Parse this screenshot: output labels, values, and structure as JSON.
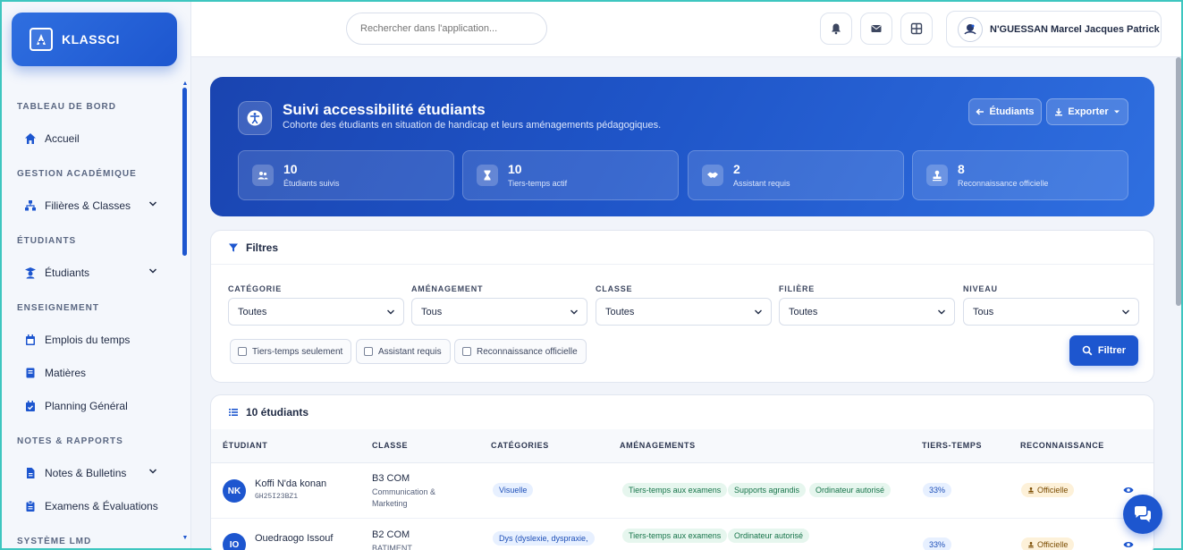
{
  "app": {
    "name": "KLASSCI"
  },
  "sidebar": {
    "sections": [
      {
        "title": "TABLEAU DE BORD",
        "items": [
          {
            "label": "Accueil",
            "icon": "home-icon"
          }
        ]
      },
      {
        "title": "GESTION ACADÉMIQUE",
        "items": [
          {
            "label": "Filières & Classes",
            "icon": "sitemap-icon",
            "expandable": true
          }
        ]
      },
      {
        "title": "ÉTUDIANTS",
        "items": [
          {
            "label": "Étudiants",
            "icon": "graduate-icon",
            "expandable": true
          }
        ]
      },
      {
        "title": "ENSEIGNEMENT",
        "items": [
          {
            "label": "Emplois du temps",
            "icon": "calendar-icon"
          },
          {
            "label": "Matières",
            "icon": "book-icon"
          },
          {
            "label": "Planning Général",
            "icon": "calendar-check-icon"
          }
        ]
      },
      {
        "title": "NOTES & RAPPORTS",
        "items": [
          {
            "label": "Notes & Bulletins",
            "icon": "file-icon",
            "expandable": true
          },
          {
            "label": "Examens & Évaluations",
            "icon": "clipboard-icon"
          }
        ]
      },
      {
        "title": "SYSTÈME LMD",
        "items": []
      }
    ]
  },
  "topbar": {
    "search_placeholder": "Rechercher dans l'application...",
    "user_name": "N'GUESSAN Marcel Jacques Patrick"
  },
  "hero": {
    "title": "Suivi accessibilité étudiants",
    "subtitle": "Cohorte des étudiants en situation de handicap et leurs aménagements pédagogiques.",
    "back_button": "Étudiants",
    "export_button": "Exporter",
    "stats": [
      {
        "value": "10",
        "label": "Étudiants suivis",
        "icon": "users-icon"
      },
      {
        "value": "10",
        "label": "Tiers-temps actif",
        "icon": "hourglass-icon"
      },
      {
        "value": "2",
        "label": "Assistant requis",
        "icon": "handshake-icon"
      },
      {
        "value": "8",
        "label": "Reconnaissance officielle",
        "icon": "stamp-icon"
      }
    ]
  },
  "filters": {
    "title": "Filtres",
    "fields": [
      {
        "label": "CATÉGORIE",
        "value": "Toutes"
      },
      {
        "label": "AMÉNAGEMENT",
        "value": "Tous"
      },
      {
        "label": "CLASSE",
        "value": "Toutes"
      },
      {
        "label": "FILIÈRE",
        "value": "Toutes"
      },
      {
        "label": "NIVEAU",
        "value": "Tous"
      }
    ],
    "checkboxes": [
      "Tiers-temps seulement",
      "Assistant requis",
      "Reconnaissance officielle"
    ],
    "submit": "Filtrer"
  },
  "table": {
    "title": "10 étudiants",
    "columns": [
      "ÉTUDIANT",
      "CLASSE",
      "CATÉGORIES",
      "AMÉNAGEMENTS",
      "TIERS-TEMPS",
      "RECONNAISSANCE"
    ],
    "rows": [
      {
        "initials": "NK",
        "name": "Koffi N'da konan",
        "matricule": "GH25I23BZ1",
        "class": "B3 COM",
        "class_sub": "Communication & Marketing",
        "categories": [
          "Visuelle"
        ],
        "amenagements": [
          "Tiers-temps aux examens",
          "Supports agrandis",
          "Ordinateur autorisé"
        ],
        "tiers_temps": "33%",
        "reconnaissance": "Officielle"
      },
      {
        "initials": "IO",
        "name": "Ouedraogo Issouf",
        "matricule": "",
        "class": "B2 COM",
        "class_sub": "BATIMENT",
        "categories": [
          "Dys (dyslexie, dyspraxie,"
        ],
        "amenagements": [
          "Tiers-temps aux examens",
          "Ordinateur autorisé"
        ],
        "tiers_temps": "33%",
        "reconnaissance": "Officielle"
      }
    ]
  }
}
